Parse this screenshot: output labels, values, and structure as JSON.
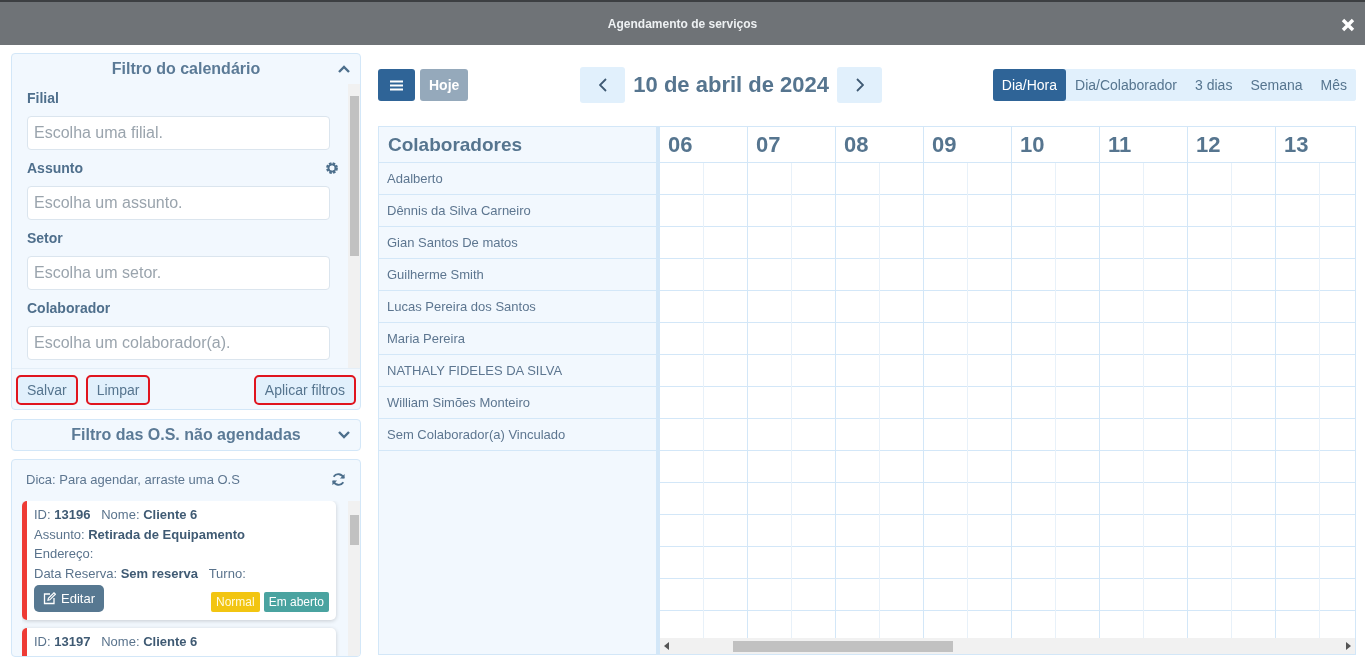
{
  "window": {
    "title": "Agendamento de serviços"
  },
  "calendar_filter": {
    "title": "Filtro do calendário",
    "expanded": true,
    "fields": [
      {
        "label": "Filial",
        "placeholder": "Escolha uma filial.",
        "settings": false
      },
      {
        "label": "Assunto",
        "placeholder": "Escolha um assunto.",
        "settings": true
      },
      {
        "label": "Setor",
        "placeholder": "Escolha um setor.",
        "settings": false
      },
      {
        "label": "Colaborador",
        "placeholder": "Escolha um colaborador(a).",
        "settings": false
      }
    ],
    "buttons": [
      {
        "label": "Salvar",
        "highlighted": true
      },
      {
        "label": "Limpar",
        "highlighted": true
      },
      {
        "label": "Aplicar filtros",
        "highlighted": true
      }
    ]
  },
  "os_filter": {
    "title": "Filtro das O.S. não agendadas",
    "expanded": false
  },
  "unscheduled": {
    "hint": "Dica: Para agendar, arraste uma O.S",
    "orders": [
      {
        "lines": [
          "ID: **13196**   Nome: **Cliente 6**",
          "Assunto: **Retirada de Equipamento**",
          "Endereço:",
          "Data Reserva: **Sem reserva**   Turno:"
        ],
        "edit_label": "Editar",
        "tags": [
          {
            "label": "Normal",
            "color": "#f2c511"
          },
          {
            "label": "Em aberto",
            "color": "#4aa3a0"
          }
        ]
      },
      {
        "lines": [
          "ID: **13197**   Nome: **Cliente 6**"
        ]
      }
    ]
  },
  "toolbar": {
    "today": "Hoje",
    "date": "10 de abril de 2024",
    "views": [
      {
        "label": "Dia/Hora",
        "selected": true
      },
      {
        "label": "Dia/Colaborador",
        "selected": false
      },
      {
        "label": "3 dias",
        "selected": false
      },
      {
        "label": "Semana",
        "selected": false
      },
      {
        "label": "Mês",
        "selected": false
      }
    ]
  },
  "schedule": {
    "resource_header": "Colaboradores",
    "hours": [
      "06",
      "07",
      "08",
      "09",
      "10",
      "11",
      "12",
      "13"
    ],
    "rows": [
      "Adalberto",
      "Dênnis da Silva Carneiro",
      "Gian Santos De matos",
      "Guilherme Smith",
      "Lucas Pereira dos Santos",
      "Maria Pereira",
      "NATHALY FIDELES DA SILVA",
      "William Simões Monteiro",
      "Sem Colaborador(a) Vinculado"
    ]
  }
}
